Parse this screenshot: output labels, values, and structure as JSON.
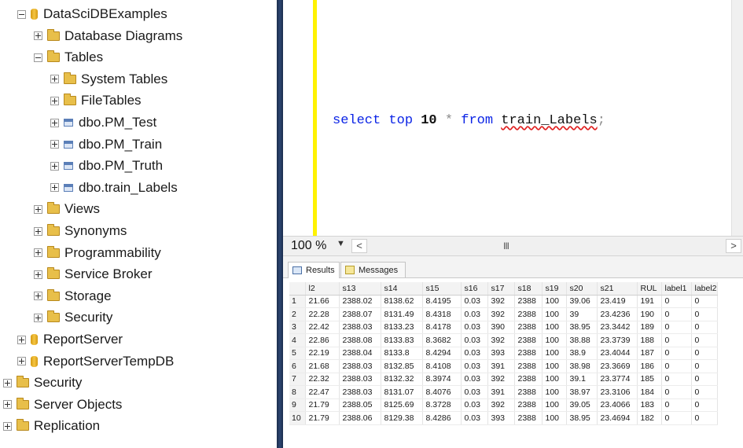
{
  "tree": {
    "items": [
      {
        "label": "DataSciDBExamples",
        "icon": "database-icon",
        "expander": "minus",
        "level": 1
      },
      {
        "label": "Database Diagrams",
        "icon": "folder-icon",
        "expander": "plus",
        "level": 2
      },
      {
        "label": "Tables",
        "icon": "folder-icon",
        "expander": "minus",
        "level": 2
      },
      {
        "label": "System Tables",
        "icon": "folder-icon",
        "expander": "plus",
        "level": 3
      },
      {
        "label": "FileTables",
        "icon": "folder-icon",
        "expander": "plus",
        "level": 3
      },
      {
        "label": "dbo.PM_Test",
        "icon": "table-icon",
        "expander": "plus",
        "level": 3
      },
      {
        "label": "dbo.PM_Train",
        "icon": "table-icon",
        "expander": "plus",
        "level": 3
      },
      {
        "label": "dbo.PM_Truth",
        "icon": "table-icon",
        "expander": "plus",
        "level": 3
      },
      {
        "label": "dbo.train_Labels",
        "icon": "table-icon",
        "expander": "plus",
        "level": 3
      },
      {
        "label": "Views",
        "icon": "folder-icon",
        "expander": "plus",
        "level": 2
      },
      {
        "label": "Synonyms",
        "icon": "folder-icon",
        "expander": "plus",
        "level": 2
      },
      {
        "label": "Programmability",
        "icon": "folder-icon",
        "expander": "plus",
        "level": 2
      },
      {
        "label": "Service Broker",
        "icon": "folder-icon",
        "expander": "plus",
        "level": 2
      },
      {
        "label": "Storage",
        "icon": "folder-icon",
        "expander": "plus",
        "level": 2
      },
      {
        "label": "Security",
        "icon": "folder-icon",
        "expander": "plus",
        "level": 2
      },
      {
        "label": "ReportServer",
        "icon": "database-icon",
        "expander": "plus",
        "level": 1
      },
      {
        "label": "ReportServerTempDB",
        "icon": "database-icon",
        "expander": "plus",
        "level": 1
      },
      {
        "label": "Security",
        "icon": "folder-icon",
        "expander": "plus",
        "level": 0
      },
      {
        "label": "Server Objects",
        "icon": "folder-icon",
        "expander": "plus",
        "level": 0
      },
      {
        "label": "Replication",
        "icon": "folder-icon",
        "expander": "plus",
        "level": 0
      }
    ]
  },
  "editor": {
    "sql": {
      "kw_select": "select",
      "kw_top": "top",
      "num": "10",
      "star": "*",
      "kw_from": "from",
      "table": "train_Labels",
      "semicolon": ";"
    },
    "zoom": "100 %",
    "zoom_dropdown_icon": "▼",
    "scroll_left_icon": "<",
    "scroll_thumb_icon": "III",
    "scroll_right_icon": ">"
  },
  "results": {
    "tabs": [
      {
        "label": "Results",
        "icon": "grid-icon",
        "active": true
      },
      {
        "label": "Messages",
        "icon": "messages-icon",
        "active": false
      }
    ],
    "columns": [
      "",
      "l2",
      "s13",
      "s14",
      "s15",
      "s16",
      "s17",
      "s18",
      "s19",
      "s20",
      "s21",
      "RUL",
      "label1",
      "label2"
    ],
    "rows": [
      [
        "1",
        "21.66",
        "2388.02",
        "8138.62",
        "8.4195",
        "0.03",
        "392",
        "2388",
        "100",
        "39.06",
        "23.419",
        "191",
        "0",
        "0"
      ],
      [
        "2",
        "22.28",
        "2388.07",
        "8131.49",
        "8.4318",
        "0.03",
        "392",
        "2388",
        "100",
        "39",
        "23.4236",
        "190",
        "0",
        "0"
      ],
      [
        "3",
        "22.42",
        "2388.03",
        "8133.23",
        "8.4178",
        "0.03",
        "390",
        "2388",
        "100",
        "38.95",
        "23.3442",
        "189",
        "0",
        "0"
      ],
      [
        "4",
        "22.86",
        "2388.08",
        "8133.83",
        "8.3682",
        "0.03",
        "392",
        "2388",
        "100",
        "38.88",
        "23.3739",
        "188",
        "0",
        "0"
      ],
      [
        "5",
        "22.19",
        "2388.04",
        "8133.8",
        "8.4294",
        "0.03",
        "393",
        "2388",
        "100",
        "38.9",
        "23.4044",
        "187",
        "0",
        "0"
      ],
      [
        "6",
        "21.68",
        "2388.03",
        "8132.85",
        "8.4108",
        "0.03",
        "391",
        "2388",
        "100",
        "38.98",
        "23.3669",
        "186",
        "0",
        "0"
      ],
      [
        "7",
        "22.32",
        "2388.03",
        "8132.32",
        "8.3974",
        "0.03",
        "392",
        "2388",
        "100",
        "39.1",
        "23.3774",
        "185",
        "0",
        "0"
      ],
      [
        "8",
        "22.47",
        "2388.03",
        "8131.07",
        "8.4076",
        "0.03",
        "391",
        "2388",
        "100",
        "38.97",
        "23.3106",
        "184",
        "0",
        "0"
      ],
      [
        "9",
        "21.79",
        "2388.05",
        "8125.69",
        "8.3728",
        "0.03",
        "392",
        "2388",
        "100",
        "39.05",
        "23.4066",
        "183",
        "0",
        "0"
      ],
      [
        "10",
        "21.79",
        "2388.06",
        "8129.38",
        "8.4286",
        "0.03",
        "393",
        "2388",
        "100",
        "38.95",
        "23.4694",
        "182",
        "0",
        "0"
      ]
    ]
  },
  "colors": {
    "splitter": "#1b2d4d",
    "keyword": "#0b24e6",
    "margin_highlight": "#fff200",
    "squiggle": "#e02020"
  }
}
